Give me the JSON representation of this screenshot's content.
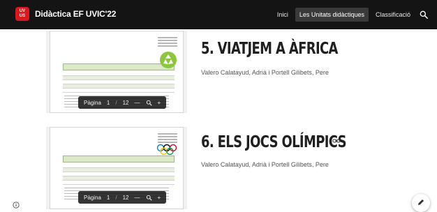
{
  "header": {
    "logo_text": "UV\nUS",
    "site_title": "Didàctica EF UVIC'22",
    "nav": [
      {
        "label": "Inici",
        "active": false
      },
      {
        "label": "Les Unitats didàctiques",
        "active": true
      },
      {
        "label": "Classificació",
        "active": false
      }
    ]
  },
  "units": [
    {
      "title": "5. VIATJEM A ÀFRICA",
      "authors": "Valero Calatayud, Adrià i Portell Gilibets, Pere",
      "preview": {
        "page_label": "Pàgina",
        "current_page": "1",
        "separator": "/",
        "total_pages": "12",
        "minus": "—",
        "plus": "+"
      }
    },
    {
      "title": "6. ELS JOCS OLÍMPICS",
      "authors": "Valero Calatayud, Adrià i Portell Gilibets, Pere",
      "preview": {
        "page_label": "Pàgina",
        "current_page": "1",
        "separator": "/",
        "total_pages": "12",
        "minus": "—",
        "plus": "+"
      }
    }
  ],
  "colors": {
    "topbar": "#141414",
    "active_nav": "#3a3a3a",
    "logo_red": "#d71920"
  },
  "icons": [
    "search-icon",
    "zoom-in-icon",
    "link-icon",
    "info-icon",
    "edit-icon",
    "recycle-icon",
    "olympic-rings-icon"
  ]
}
